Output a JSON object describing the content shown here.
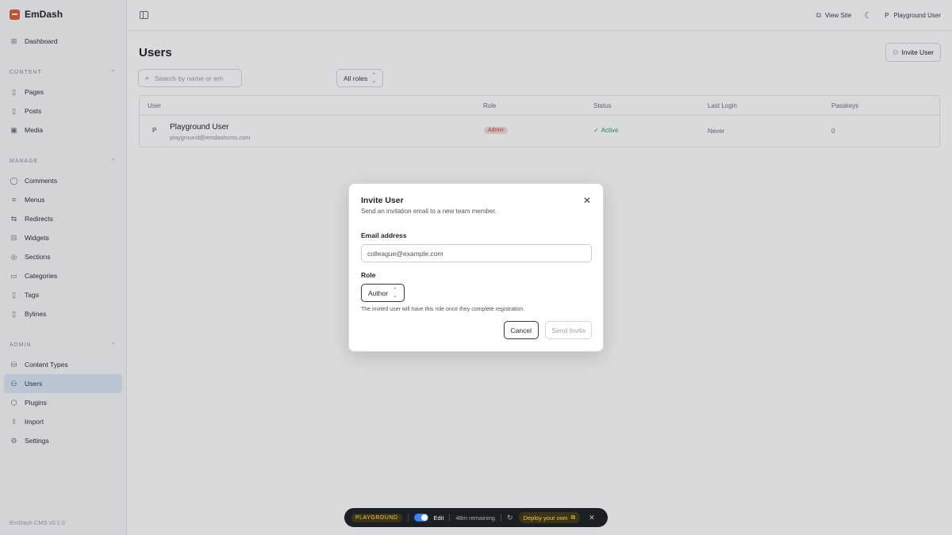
{
  "app": {
    "name": "EmDash",
    "version": "EmDash CMS v0.1.0"
  },
  "sidebar": {
    "dashboard": "Dashboard",
    "sections": [
      {
        "title": "CONTENT",
        "items": [
          "Pages",
          "Posts",
          "Media"
        ]
      },
      {
        "title": "MANAGE",
        "items": [
          "Comments",
          "Menus",
          "Redirects",
          "Widgets",
          "Sections",
          "Categories",
          "Tags",
          "Bylines"
        ]
      },
      {
        "title": "ADMIN",
        "items": [
          "Content Types",
          "Users",
          "Plugins",
          "Import",
          "Settings"
        ]
      }
    ],
    "active": "Users"
  },
  "topbar": {
    "view_site": "View Site",
    "user_initial": "P",
    "user_name": "Playground User"
  },
  "page": {
    "title": "Users",
    "invite_button": "Invite User",
    "search_placeholder": "Search by name or em",
    "roles_filter": "All roles"
  },
  "table": {
    "headers": [
      "User",
      "Role",
      "Status",
      "Last Login",
      "Passkeys"
    ],
    "rows": [
      {
        "initial": "P",
        "name": "Playground User",
        "email": "playground@emdashcms.com",
        "role": "Admin",
        "status": "Active",
        "last_login": "Never",
        "passkeys": "0"
      }
    ]
  },
  "dialog": {
    "title": "Invite User",
    "subtitle": "Send an invitation email to a new team member.",
    "email_label": "Email address",
    "email_placeholder": "colleague@example.com",
    "role_label": "Role",
    "role_value": "Author",
    "hint": "The invited user will have this role once they complete registration.",
    "cancel": "Cancel",
    "send": "Send Invite"
  },
  "playground": {
    "badge": "PLAYGROUND",
    "edit": "Edit",
    "remaining": "48m remaining",
    "deploy": "Deploy your own",
    "edit_enabled": true
  },
  "colors": {
    "accent": "#3b82f6",
    "brand": "#e25c3b",
    "playground": "#f0c94a"
  }
}
